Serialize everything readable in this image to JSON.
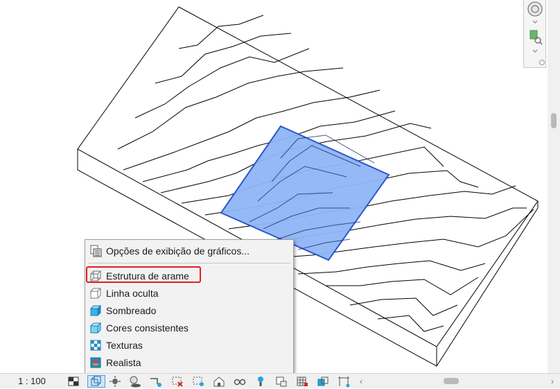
{
  "menu": {
    "header_item": {
      "label": "Opções de exibição de gráficos...",
      "icon": "graphic-display-options-icon"
    },
    "items": [
      {
        "label": "Estrutura de arame",
        "icon": "wireframe-icon",
        "highlighted": true
      },
      {
        "label": "Linha oculta",
        "icon": "hidden-line-icon"
      },
      {
        "label": "Sombreado",
        "icon": "shaded-icon"
      },
      {
        "label": "Cores consistentes",
        "icon": "consistent-colors-icon"
      },
      {
        "label": "Texturas",
        "icon": "textures-icon"
      },
      {
        "label": "Realista",
        "icon": "realistic-icon"
      }
    ]
  },
  "statusbar": {
    "scale": "1 : 100"
  },
  "colors": {
    "highlight_border": "#e0201f",
    "selection_fill": "#8fb4f5",
    "selection_stroke": "#2a56c8",
    "menu_bg": "#f2f2f2"
  }
}
